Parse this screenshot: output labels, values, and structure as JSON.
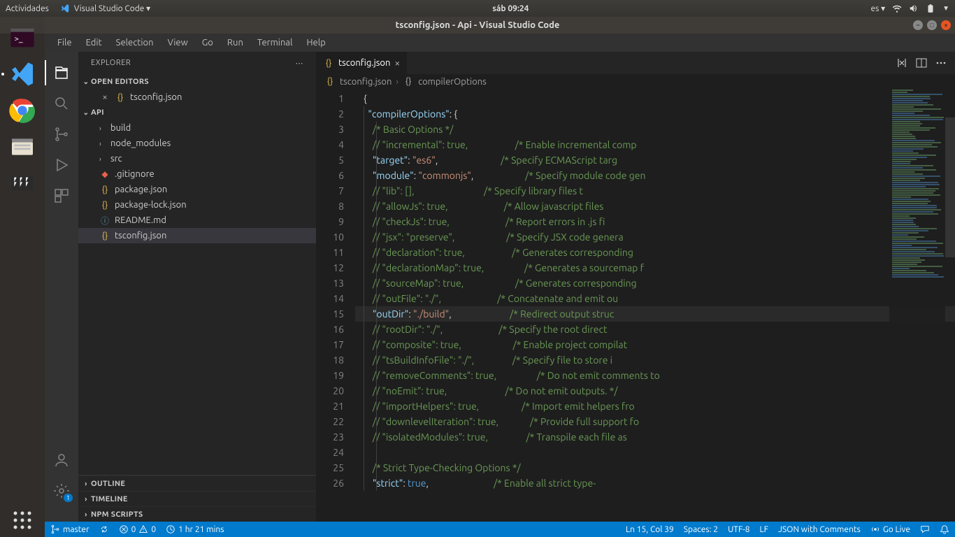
{
  "system": {
    "activities": "Actividades",
    "app_label": "Visual Studio Code ▾",
    "clock": "sáb 09:24",
    "lang": "es ▾"
  },
  "window": {
    "title": "tsconfig.json - Api - Visual Studio Code"
  },
  "menu": [
    "File",
    "Edit",
    "Selection",
    "View",
    "Go",
    "Run",
    "Terminal",
    "Help"
  ],
  "sidebar": {
    "title": "EXPLORER",
    "open_editors": "OPEN EDITORS",
    "open_file": "tsconfig.json",
    "workspace": "API",
    "tree": [
      {
        "type": "folder",
        "label": "build"
      },
      {
        "type": "folder",
        "label": "node_modules"
      },
      {
        "type": "folder",
        "label": "src"
      },
      {
        "type": "file",
        "label": ".gitignore",
        "icon": "git"
      },
      {
        "type": "file",
        "label": "package.json",
        "icon": "json"
      },
      {
        "type": "file",
        "label": "package-lock.json",
        "icon": "json"
      },
      {
        "type": "file",
        "label": "README.md",
        "icon": "md"
      },
      {
        "type": "file",
        "label": "tsconfig.json",
        "icon": "json",
        "selected": true
      }
    ],
    "outline": "OUTLINE",
    "timeline": "TIMELINE",
    "npm_scripts": "NPM SCRIPTS"
  },
  "tab": {
    "label": "tsconfig.json"
  },
  "breadcrumb": {
    "file": "tsconfig.json",
    "symbol": "compilerOptions"
  },
  "code": {
    "lines": [
      {
        "n": 1,
        "indent": 0,
        "seg": [
          {
            "t": "{",
            "c": "punc"
          }
        ]
      },
      {
        "n": 2,
        "indent": 1,
        "seg": [
          {
            "t": "\"compilerOptions\"",
            "c": "key"
          },
          {
            "t": ": ",
            "c": "punc"
          },
          {
            "t": "{",
            "c": "punc"
          }
        ]
      },
      {
        "n": 3,
        "indent": 2,
        "seg": [
          {
            "t": "/* Basic Options */",
            "c": "com"
          }
        ]
      },
      {
        "n": 4,
        "indent": 2,
        "seg": [
          {
            "t": "// \"incremental\": true,",
            "c": "com"
          }
        ],
        "tail": "/* Enable incremental comp"
      },
      {
        "n": 5,
        "indent": 2,
        "seg": [
          {
            "t": "\"target\"",
            "c": "key"
          },
          {
            "t": ": ",
            "c": "punc"
          },
          {
            "t": "\"es6\"",
            "c": "str"
          },
          {
            "t": ",",
            "c": "punc"
          }
        ],
        "tail": "/* Specify ECMAScript targ"
      },
      {
        "n": 6,
        "indent": 2,
        "seg": [
          {
            "t": "\"module\"",
            "c": "key"
          },
          {
            "t": ": ",
            "c": "punc"
          },
          {
            "t": "\"commonjs\"",
            "c": "str"
          },
          {
            "t": ",",
            "c": "punc"
          }
        ],
        "tail": "/* Specify module code gen"
      },
      {
        "n": 7,
        "indent": 2,
        "seg": [
          {
            "t": "// \"lib\": [],",
            "c": "com"
          }
        ],
        "tail": "/* Specify library files t"
      },
      {
        "n": 8,
        "indent": 2,
        "seg": [
          {
            "t": "// \"allowJs\": true,",
            "c": "com"
          }
        ],
        "tail": "/* Allow javascript files "
      },
      {
        "n": 9,
        "indent": 2,
        "seg": [
          {
            "t": "// \"checkJs\": true,",
            "c": "com"
          }
        ],
        "tail": "/* Report errors in .js fi"
      },
      {
        "n": 10,
        "indent": 2,
        "seg": [
          {
            "t": "// \"jsx\": \"preserve\",",
            "c": "com"
          }
        ],
        "tail": "/* Specify JSX code genera"
      },
      {
        "n": 11,
        "indent": 2,
        "seg": [
          {
            "t": "// \"declaration\": true,",
            "c": "com"
          }
        ],
        "tail": "/* Generates corresponding"
      },
      {
        "n": 12,
        "indent": 2,
        "seg": [
          {
            "t": "// \"declarationMap\": true,",
            "c": "com"
          }
        ],
        "tail": "/* Generates a sourcemap f"
      },
      {
        "n": 13,
        "indent": 2,
        "seg": [
          {
            "t": "// \"sourceMap\": true,",
            "c": "com"
          }
        ],
        "tail": "/* Generates corresponding"
      },
      {
        "n": 14,
        "indent": 2,
        "seg": [
          {
            "t": "// \"outFile\": \"./\",",
            "c": "com"
          }
        ],
        "tail": "/* Concatenate and emit ou"
      },
      {
        "n": 15,
        "indent": 2,
        "hl": true,
        "seg": [
          {
            "t": "\"outDir\"",
            "c": "key"
          },
          {
            "t": ": ",
            "c": "punc"
          },
          {
            "t": "\"./build\"",
            "c": "str"
          },
          {
            "t": ",",
            "c": "punc"
          }
        ],
        "tail": "  /* Redirect output struc"
      },
      {
        "n": 16,
        "indent": 2,
        "seg": [
          {
            "t": "// \"rootDir\": \"./\",",
            "c": "com"
          }
        ],
        "tail": "/* Specify the root direct"
      },
      {
        "n": 17,
        "indent": 2,
        "seg": [
          {
            "t": "// \"composite\": true,",
            "c": "com"
          }
        ],
        "tail": "/* Enable project compilat"
      },
      {
        "n": 18,
        "indent": 2,
        "seg": [
          {
            "t": "// \"tsBuildInfoFile\": \"./\",",
            "c": "com"
          }
        ],
        "tail": "/* Specify file to store i"
      },
      {
        "n": 19,
        "indent": 2,
        "seg": [
          {
            "t": "// \"removeComments\": true,",
            "c": "com"
          }
        ],
        "tail": "/* Do not emit comments to"
      },
      {
        "n": 20,
        "indent": 2,
        "seg": [
          {
            "t": "// \"noEmit\": true,",
            "c": "com"
          }
        ],
        "tail": "/* Do not emit outputs. */"
      },
      {
        "n": 21,
        "indent": 2,
        "seg": [
          {
            "t": "// \"importHelpers\": true,",
            "c": "com"
          }
        ],
        "tail": "/* Import emit helpers fro"
      },
      {
        "n": 22,
        "indent": 2,
        "seg": [
          {
            "t": "// \"downlevelIteration\": true,",
            "c": "com"
          }
        ],
        "tail": "/* Provide full support fo"
      },
      {
        "n": 23,
        "indent": 2,
        "seg": [
          {
            "t": "// \"isolatedModules\": true,",
            "c": "com"
          }
        ],
        "tail": "/* Transpile each file as "
      },
      {
        "n": 24,
        "indent": 2,
        "seg": []
      },
      {
        "n": 25,
        "indent": 2,
        "seg": [
          {
            "t": "/* Strict Type-Checking Options */",
            "c": "com"
          }
        ]
      },
      {
        "n": 26,
        "indent": 2,
        "seg": [
          {
            "t": "\"strict\"",
            "c": "key"
          },
          {
            "t": ": ",
            "c": "punc"
          },
          {
            "t": "true",
            "c": "bool"
          },
          {
            "t": ",",
            "c": "punc"
          }
        ],
        "tail": "/* Enable all strict type-"
      }
    ],
    "tail_col": 48
  },
  "status": {
    "branch": "master",
    "sync": "",
    "errors": "0",
    "warnings": "0",
    "time": "1 hr 21 mins",
    "position": "Ln 15, Col 39",
    "spaces": "Spaces: 2",
    "encoding": "UTF-8",
    "eol": "LF",
    "lang": "JSON with Comments",
    "golive": "Go Live"
  },
  "activity_badge": "1"
}
